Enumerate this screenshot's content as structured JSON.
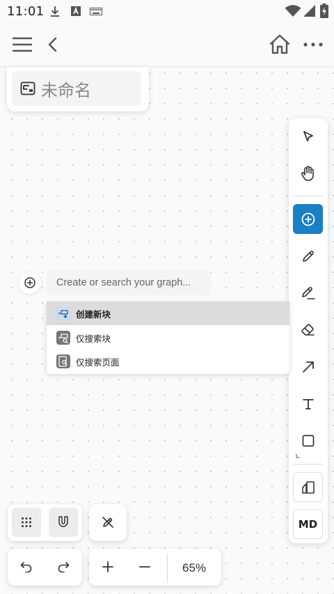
{
  "status_bar": {
    "time": "11:01",
    "icons": [
      "download-icon",
      "a-notification-icon",
      "keyboard-icon",
      "wifi-icon",
      "signal-icon",
      "battery-charging-icon"
    ]
  },
  "header": {
    "icons": [
      "menu-icon",
      "back-icon",
      "home-icon",
      "more-icon"
    ]
  },
  "title": {
    "text": "未命名",
    "icon": "frame-icon"
  },
  "toolbar": {
    "tools": [
      "select-tool",
      "pan-tool",
      "add-tool",
      "pen-tool",
      "highlighter-tool",
      "eraser-tool",
      "arrow-tool",
      "text-tool",
      "shape-tool"
    ],
    "active": "add-tool",
    "md_label": "MD",
    "accent_color": "#1a7fc4"
  },
  "search": {
    "placeholder": "Create or search your graph...",
    "value": ""
  },
  "dropdown": {
    "items": [
      {
        "label": "创建新块",
        "selected": true,
        "icon": "new-block-icon"
      },
      {
        "label": "仅搜索块",
        "selected": false,
        "icon": "search-block-icon"
      },
      {
        "label": "仅搜索页面",
        "selected": false,
        "icon": "search-page-icon"
      }
    ]
  },
  "bottom": {
    "zoom": "65%",
    "icons": [
      "grid-icon",
      "snap-magnet-icon",
      "pen-off-icon",
      "undo-icon",
      "redo-icon",
      "zoom-in-icon",
      "zoom-out-icon"
    ]
  }
}
